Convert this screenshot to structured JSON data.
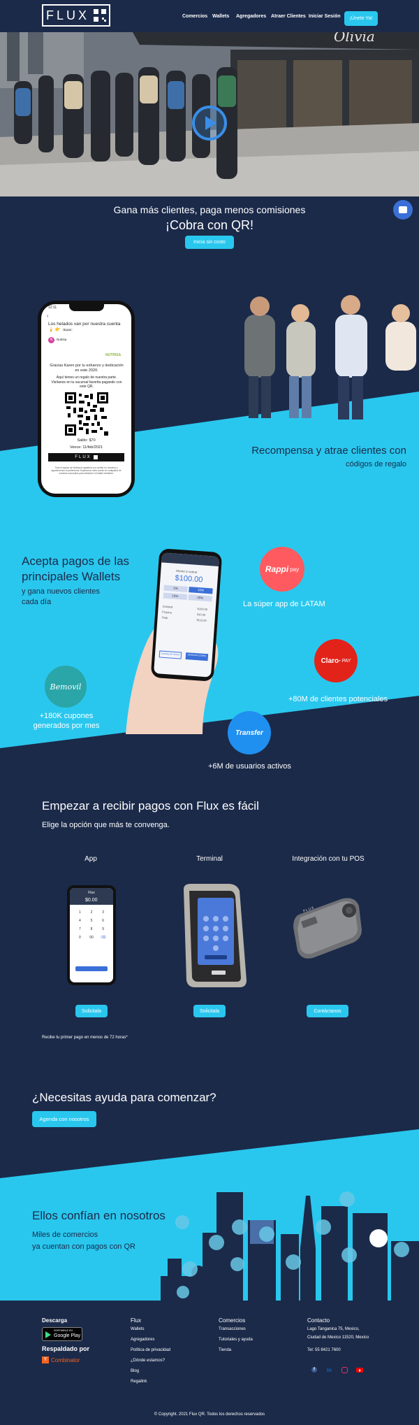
{
  "header": {
    "logo_text": "FLUX",
    "nav": [
      "Comercios",
      "Wallets",
      "Agregadores",
      "Atraer Clientes",
      "Iniciar Sesión"
    ],
    "cta": "¡Únete Ya!"
  },
  "hero": {
    "video_alt": "play-icon",
    "storefront_sign": "Olivia",
    "subtitle": "Gana más clientes, paga menos comisiones",
    "title": "¡Cobra con QR!",
    "cta": "Inicia sin costo"
  },
  "rewards": {
    "phone": {
      "time": "12:11",
      "subject": "Los helados van por nuestra cuenta 🍦 👉",
      "tag": "Buzón",
      "sender_initial": "N",
      "sender": "Nutrisa",
      "brand": "NUTRISA",
      "thanks": "Gracias Karen por tu esfuerzo y dedicación en este 2020.",
      "gift_text": "Aquí tienes un regalo de nuestra parte. Visítanos en tu sucursal favorita pagando con este QR.",
      "balance": "Saldo: $70",
      "expiry": "Vence: 11/feb/2021",
      "footer_logo": "FLUX",
      "fine_print": "Todo el equipo de Nutrisa te agradece por confiar en nosotros y agradecemos tu preferencia. Esperamos verte pronto en cualquiera de nuestras sucursales para fortalecer tu lealtad mediante."
    },
    "heading_1": "Recompensa y atrae clientes con",
    "heading_2": "códigos de regalo"
  },
  "wallets": {
    "heading_1": "Acepta pagos de las",
    "heading_2": "principales Wallets",
    "sub_1": "y gana nuevos clientes",
    "sub_2": "cada día",
    "phone": {
      "label": "Monto a cobrar",
      "amount": "$100.00",
      "tips": [
        "5%",
        "10%",
        "15%",
        "20%"
      ],
      "lines": [
        "Subtotal",
        "Propina",
        "Total"
      ],
      "vals": [
        "$100.00",
        "$10.00",
        "$110.00"
      ],
      "btn1": "CANCELAR VENTA",
      "btn2": "GENERAR COBRO"
    },
    "rappi_brand": "Rappi",
    "rappi_sub": "pay",
    "rappi": "La súper app de LATAM",
    "claro_brand": "Claro·",
    "claro_sub": "PAY",
    "claro": "+80M de clientes potenciales",
    "bemovil_brand": "Bemovil",
    "bemovil_1": "+180K cupones",
    "bemovil_2": "generados por mes",
    "transfer_brand": "Transfer",
    "transfer": "+6M de usuarios activos"
  },
  "start": {
    "heading": "Empezar a recibir pagos con Flux es fácil",
    "sub": "Elige la opción que más te convenga.",
    "options": [
      {
        "title": "App",
        "button": "Solicitala"
      },
      {
        "title": "Terminal",
        "button": "Solicitala"
      },
      {
        "title": "Integración con tu POS",
        "button": "Contáctanos"
      }
    ],
    "app_screen": {
      "header": "Flux",
      "amount": "$0.00",
      "keys": [
        "1",
        "2",
        "3",
        "4",
        "5",
        "6",
        "7",
        "8",
        "9",
        "0",
        "00",
        "⌫"
      ]
    },
    "pos_label": "FLUX",
    "note": "Recibe tu primer pago en menos de 72 horas*"
  },
  "help": {
    "heading": "¿Necesitas ayuda para comenzar?",
    "cta": "Agenda con nosotros"
  },
  "trust": {
    "heading": "Ellos confían en nosotros",
    "sub_1": "Miles de comercios",
    "sub_2": "ya cuentan con pagos con QR"
  },
  "footer": {
    "download_title": "Descarga",
    "play_small": "DISPONIBLE EN",
    "play_big": "Google Play",
    "backed_title": "Respaldado por",
    "yc_letter": "Y",
    "yc_name": "Combinator",
    "flux_title": "Flux",
    "flux_links": [
      "Wallets",
      "Agregadores",
      "Política de privacidad",
      "¿Dónde estamos?",
      "Blog",
      "Regalink"
    ],
    "commerce_title": "Comercios",
    "commerce_links": [
      "Transacciones",
      "Tutoriales y ayuda",
      "Tienda"
    ],
    "contact_title": "Contacto",
    "address_1": "Lago Tanganica 75, Mexico,",
    "address_2": "Ciudad de Mexico 11520, Mexico",
    "phone": "Tel: 55 8421 7600",
    "social": [
      "facebook-icon",
      "linkedin-icon",
      "instagram-icon",
      "youtube-icon"
    ],
    "copyright": "© Copyright. 2021 Flux QR. Todos los derechos reservados"
  },
  "colors": {
    "navy": "#1b2a49",
    "cyan": "#29c7ee",
    "rappi": "#ff5a5f",
    "claro": "#e2231a",
    "transfer": "#1f8ff0",
    "bemovil": "#2aa5a8"
  }
}
